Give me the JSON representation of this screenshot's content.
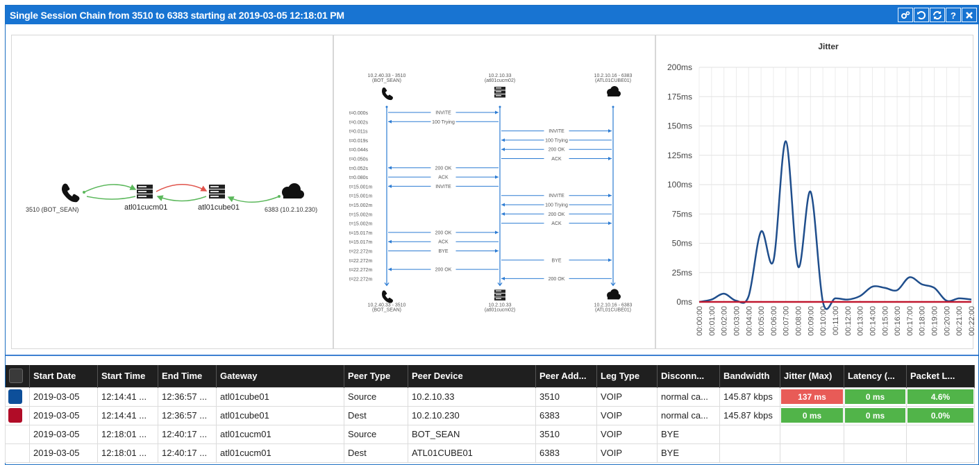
{
  "window": {
    "title": "Single Session Chain from 3510 to 6383 starting at 2019-03-05 12:18:01 PM",
    "buttons": [
      "settings-icon",
      "undo-icon",
      "refresh-icon",
      "help-icon",
      "close-icon"
    ],
    "accent": "#1874d2"
  },
  "topology": {
    "nodes": [
      {
        "label": "3510 (BOT_SEAN)",
        "icon": "phone-icon"
      },
      {
        "label": "atl01cucm01",
        "icon": "server-icon"
      },
      {
        "label": "atl01cube01",
        "icon": "server-icon"
      },
      {
        "label": "6383 (10.2.10.230)",
        "icon": "cloud-icon"
      }
    ]
  },
  "ladder": {
    "endpoints": [
      {
        "top": "10.2.40.33 - 3510",
        "sub": "(BOT_SEAN)",
        "icon": "phone-icon"
      },
      {
        "top": "10.2.10.33",
        "sub": "(atl01cucm02)",
        "icon": "server-icon"
      },
      {
        "top": "10.2.10.16 - 6383",
        "sub": "(ATL01CUBE01)",
        "icon": "cloud-icon"
      }
    ],
    "messages": [
      {
        "t": "t=0.000s",
        "from": 0,
        "to": 1,
        "label": "INVITE"
      },
      {
        "t": "t=0.002s",
        "from": 1,
        "to": 0,
        "label": "100 Trying"
      },
      {
        "t": "t=0.011s",
        "from": 1,
        "to": 2,
        "label": "INVITE"
      },
      {
        "t": "t=0.019s",
        "from": 2,
        "to": 1,
        "label": "100 Trying"
      },
      {
        "t": "t=0.044s",
        "from": 2,
        "to": 1,
        "label": "200 OK"
      },
      {
        "t": "t=0.050s",
        "from": 1,
        "to": 2,
        "label": "ACK"
      },
      {
        "t": "t=0.052s",
        "from": 1,
        "to": 0,
        "label": "200 OK"
      },
      {
        "t": "t=0.080s",
        "from": 0,
        "to": 1,
        "label": "ACK"
      },
      {
        "t": "t=15.001m",
        "from": 1,
        "to": 0,
        "label": "INVITE"
      },
      {
        "t": "t=15.001m",
        "from": 1,
        "to": 2,
        "label": "INVITE"
      },
      {
        "t": "t=15.002m",
        "from": 2,
        "to": 1,
        "label": "100 Trying"
      },
      {
        "t": "t=15.002m",
        "from": 2,
        "to": 1,
        "label": "200 OK"
      },
      {
        "t": "t=15.002m",
        "from": 1,
        "to": 2,
        "label": "ACK"
      },
      {
        "t": "t=15.017m",
        "from": 0,
        "to": 1,
        "label": "200 OK"
      },
      {
        "t": "t=15.017m",
        "from": 1,
        "to": 0,
        "label": "ACK"
      },
      {
        "t": "t=22.272m",
        "from": 0,
        "to": 1,
        "label": "BYE"
      },
      {
        "t": "t=22.272m",
        "from": 1,
        "to": 2,
        "label": "BYE"
      },
      {
        "t": "t=22.272m",
        "from": 1,
        "to": 0,
        "label": "200 OK"
      },
      {
        "t": "t=22.272m",
        "from": 2,
        "to": 1,
        "label": "200 OK"
      }
    ]
  },
  "chart_data": {
    "type": "line",
    "title": "Jitter",
    "xlabel": "",
    "ylabel": "",
    "ylim": [
      0,
      200
    ],
    "yticks": [
      "0ms",
      "25ms",
      "50ms",
      "75ms",
      "100ms",
      "125ms",
      "150ms",
      "175ms",
      "200ms"
    ],
    "x": [
      "00:00:00",
      "00:01:00",
      "00:02:00",
      "00:03:00",
      "00:04:00",
      "00:05:00",
      "00:06:00",
      "00:07:00",
      "00:08:00",
      "00:09:00",
      "00:10:00",
      "00:11:00",
      "00:12:00",
      "00:13:00",
      "00:14:00",
      "00:15:00",
      "00:16:00",
      "00:17:00",
      "00:18:00",
      "00:19:00",
      "00:20:00",
      "00:21:00",
      "00:22:00"
    ],
    "series": [
      {
        "color": "#1f4e8c",
        "values": [
          0,
          2,
          7,
          1,
          5,
          60,
          35,
          137,
          30,
          94,
          0,
          3,
          2,
          5,
          13,
          12,
          10,
          21,
          15,
          12,
          1,
          3,
          2
        ]
      },
      {
        "color": "#c0182f",
        "values": [
          0,
          0,
          0,
          0,
          0,
          0,
          0,
          0,
          0,
          0,
          0,
          0,
          0,
          0,
          0,
          0,
          0,
          0,
          0,
          0,
          0,
          0,
          0
        ]
      }
    ],
    "grid": true
  },
  "table": {
    "columns": [
      "",
      "Start Date",
      "Start Time",
      "End Time",
      "Gateway",
      "Peer Type",
      "Peer Device",
      "Peer Add...",
      "Leg Type",
      "Disconn...",
      "Bandwidth",
      "Jitter (Max)",
      "Latency (...",
      "Packet L..."
    ],
    "rows": [
      {
        "color": "#0d4f9a",
        "cells": [
          "2019-03-05",
          "12:14:41 ...",
          "12:36:57 ...",
          "atl01cube01",
          "Source",
          "10.2.10.33",
          "3510",
          "VOIP",
          "normal ca...",
          "145.87 kbps"
        ],
        "jitter": "137 ms",
        "jitter_color": "#e85b57",
        "latency": "0 ms",
        "latency_color": "#51b449",
        "loss": "4.6%",
        "loss_color": "#51b449"
      },
      {
        "color": "#b10c27",
        "cells": [
          "2019-03-05",
          "12:14:41 ...",
          "12:36:57 ...",
          "atl01cube01",
          "Dest",
          "10.2.10.230",
          "6383",
          "VOIP",
          "normal ca...",
          "145.87 kbps"
        ],
        "jitter": "0 ms",
        "jitter_color": "#51b449",
        "latency": "0 ms",
        "latency_color": "#51b449",
        "loss": "0.0%",
        "loss_color": "#51b449"
      },
      {
        "color": "",
        "cells": [
          "2019-03-05",
          "12:18:01 ...",
          "12:40:17 ...",
          "atl01cucm01",
          "Source",
          "BOT_SEAN",
          "3510",
          "VOIP",
          "BYE",
          ""
        ],
        "jitter": "",
        "jitter_color": "",
        "latency": "",
        "latency_color": "",
        "loss": "",
        "loss_color": ""
      },
      {
        "color": "",
        "cells": [
          "2019-03-05",
          "12:18:01 ...",
          "12:40:17 ...",
          "atl01cucm01",
          "Dest",
          "ATL01CUBE01",
          "6383",
          "VOIP",
          "BYE",
          ""
        ],
        "jitter": "",
        "jitter_color": "",
        "latency": "",
        "latency_color": "",
        "loss": "",
        "loss_color": ""
      }
    ]
  }
}
